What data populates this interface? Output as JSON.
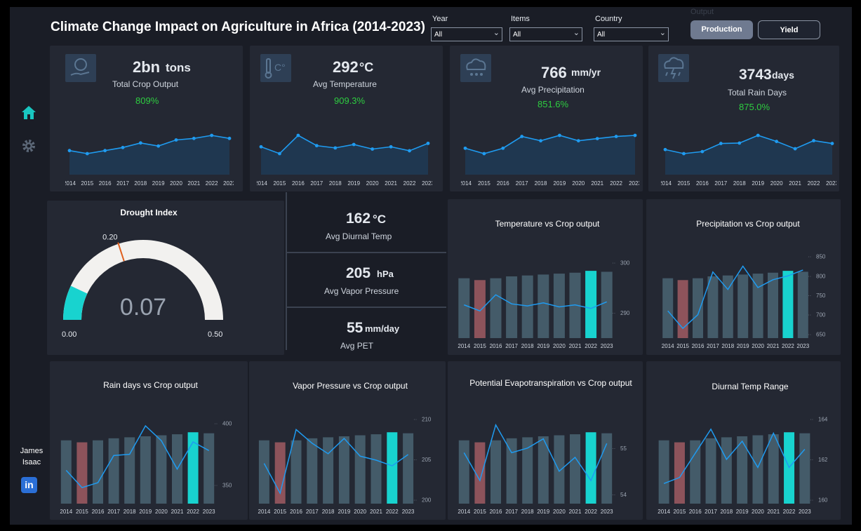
{
  "header": {
    "title": "Climate Change Impact on Agriculture in Africa (2014-2023)"
  },
  "filters": [
    {
      "label": "Year",
      "value": "All"
    },
    {
      "label": "Items",
      "value": "All"
    },
    {
      "label": "Country",
      "value": "All"
    }
  ],
  "toggle": {
    "label": "Output",
    "production": "Production",
    "yield": "Yield",
    "active": "production"
  },
  "nav": {
    "author_first": "James",
    "author_last": "Isaac",
    "linkedin": "in"
  },
  "years": [
    "2014",
    "2015",
    "2016",
    "2017",
    "2018",
    "2019",
    "2020",
    "2021",
    "2022",
    "2023"
  ],
  "kpis": [
    {
      "value": "2bn",
      "unit": "tons",
      "label": "Total Crop Output",
      "pct": "809%",
      "icon": "crop-hand-icon",
      "trend": [
        2.1,
        2.0,
        2.1,
        2.2,
        2.35,
        2.25,
        2.45,
        2.5,
        2.6,
        2.5
      ]
    },
    {
      "value": "292",
      "unit": "°C",
      "label": "Avg Temperature",
      "pct": "909.3%",
      "icon": "thermometer-icon",
      "trend": [
        291.6,
        290.4,
        293.6,
        291.8,
        291.4,
        292.0,
        291.2,
        291.6,
        290.9,
        292.2
      ]
    },
    {
      "value": "766",
      "unit": "mm/yr",
      "label": "Avg Precipitation",
      "pct": "851.6%",
      "icon": "rain-cloud-icon",
      "trend": [
        720,
        670,
        720,
        830,
        790,
        840,
        790,
        810,
        830,
        840
      ]
    },
    {
      "value": "3743",
      "unit": "days",
      "label": "Total Rain Days",
      "pct": "875.0%",
      "icon": "storm-cloud-icon",
      "trend": [
        360,
        350,
        355,
        375,
        376,
        395,
        380,
        362,
        382,
        375
      ]
    }
  ],
  "gauge": {
    "title": "Drought Index",
    "value": 0.07,
    "value_text": "0.07",
    "min": "0.00",
    "max": "0.50",
    "target": 0.2,
    "target_text": "0.20"
  },
  "mini_kpis": [
    {
      "value": "162",
      "unit": "°C",
      "label": "Avg Diurnal Temp"
    },
    {
      "value": "205",
      "unit": "hPa",
      "label": "Avg Vapor Pressure"
    },
    {
      "value": "55",
      "unit": "mm/day",
      "label": "Avg PET"
    }
  ],
  "colors": {
    "bar": "#4a6473",
    "bar_low": "#a05a63",
    "bar_high": "#18d3cf",
    "line": "#1f9bf0",
    "green": "#2ecc40"
  },
  "chart_data": [
    {
      "type": "bar",
      "title": "Temperature vs Crop output",
      "categories": [
        "2014",
        "2015",
        "2016",
        "2017",
        "2018",
        "2019",
        "2020",
        "2021",
        "2022",
        "2023"
      ],
      "series": [
        {
          "values": [
            2.1,
            2.0,
            2.1,
            2.2,
            2.25,
            2.3,
            2.35,
            2.4,
            2.5,
            2.45
          ]
        },
        {
          "values": [
            291.6,
            290.4,
            293.6,
            291.8,
            291.4,
            292.0,
            291.2,
            291.6,
            290.9,
            292.2
          ]
        }
      ],
      "y2_ticks": [
        "300",
        "290"
      ],
      "y2lim": [
        285,
        302
      ]
    },
    {
      "type": "bar",
      "title": "Precipitation vs Crop output",
      "categories": [
        "2014",
        "2015",
        "2016",
        "2017",
        "2018",
        "2019",
        "2020",
        "2021",
        "2022",
        "2023"
      ],
      "series": [
        {
          "values": [
            2.1,
            2.0,
            2.1,
            2.2,
            2.25,
            2.3,
            2.35,
            2.4,
            2.5,
            2.45
          ]
        },
        {
          "values": [
            710,
            665,
            700,
            810,
            765,
            825,
            770,
            790,
            800,
            815
          ]
        }
      ],
      "y2_ticks": [
        "850",
        "800",
        "750",
        "700",
        "650"
      ],
      "y2lim": [
        640,
        860
      ]
    },
    {
      "type": "bar",
      "title": "Rain days vs Crop output",
      "categories": [
        "2014",
        "2015",
        "2016",
        "2017",
        "2018",
        "2019",
        "2020",
        "2021",
        "2022",
        "2023"
      ],
      "series": [
        {
          "values": [
            2.1,
            2.0,
            2.1,
            2.2,
            2.25,
            2.3,
            2.35,
            2.4,
            2.5,
            2.45
          ]
        },
        {
          "values": [
            362,
            348,
            352,
            374,
            375,
            398,
            386,
            363,
            385,
            378
          ]
        }
      ],
      "y2_ticks": [
        "400",
        "350"
      ],
      "y2lim": [
        335,
        410
      ]
    },
    {
      "type": "bar",
      "title": "Vapor Pressure vs Crop output",
      "categories": [
        "2014",
        "2015",
        "2016",
        "2017",
        "2018",
        "2019",
        "2020",
        "2021",
        "2022",
        "2023"
      ],
      "series": [
        {
          "values": [
            2.1,
            2.0,
            2.1,
            2.2,
            2.25,
            2.3,
            2.35,
            2.4,
            2.5,
            2.45
          ]
        },
        {
          "values": [
            204.5,
            200.8,
            208.7,
            207.0,
            205.7,
            207.6,
            205.4,
            204.9,
            204.2,
            205.6
          ]
        }
      ],
      "y2_ticks": [
        "210",
        "205",
        "200"
      ],
      "y2lim": [
        199.5,
        211
      ]
    },
    {
      "type": "bar",
      "title": "Potential Evapotranspiration vs Crop output",
      "categories": [
        "2014",
        "2015",
        "2016",
        "2017",
        "2018",
        "2019",
        "2020",
        "2021",
        "2022",
        "2023"
      ],
      "series": [
        {
          "values": [
            2.1,
            2.0,
            2.1,
            2.2,
            2.25,
            2.3,
            2.35,
            2.4,
            2.5,
            2.45
          ]
        },
        {
          "values": [
            54.9,
            54.3,
            55.5,
            54.9,
            55.0,
            55.2,
            54.5,
            54.8,
            54.3,
            55.1
          ]
        }
      ],
      "y2_ticks": [
        "55",
        "54"
      ],
      "y2lim": [
        53.8,
        55.8
      ]
    },
    {
      "type": "bar",
      "title": "Diurnal Temp Range",
      "categories": [
        "2014",
        "2015",
        "2016",
        "2017",
        "2018",
        "2019",
        "2020",
        "2021",
        "2022",
        "2023"
      ],
      "series": [
        {
          "values": [
            2.1,
            2.0,
            2.1,
            2.2,
            2.25,
            2.3,
            2.35,
            2.4,
            2.5,
            2.45
          ]
        },
        {
          "values": [
            160.8,
            161.1,
            162.3,
            163.5,
            162.0,
            162.9,
            161.6,
            163.3,
            161.6,
            162.5
          ]
        }
      ],
      "y2_ticks": [
        "164",
        "162",
        "160"
      ],
      "y2lim": [
        159.8,
        164.4
      ]
    }
  ]
}
